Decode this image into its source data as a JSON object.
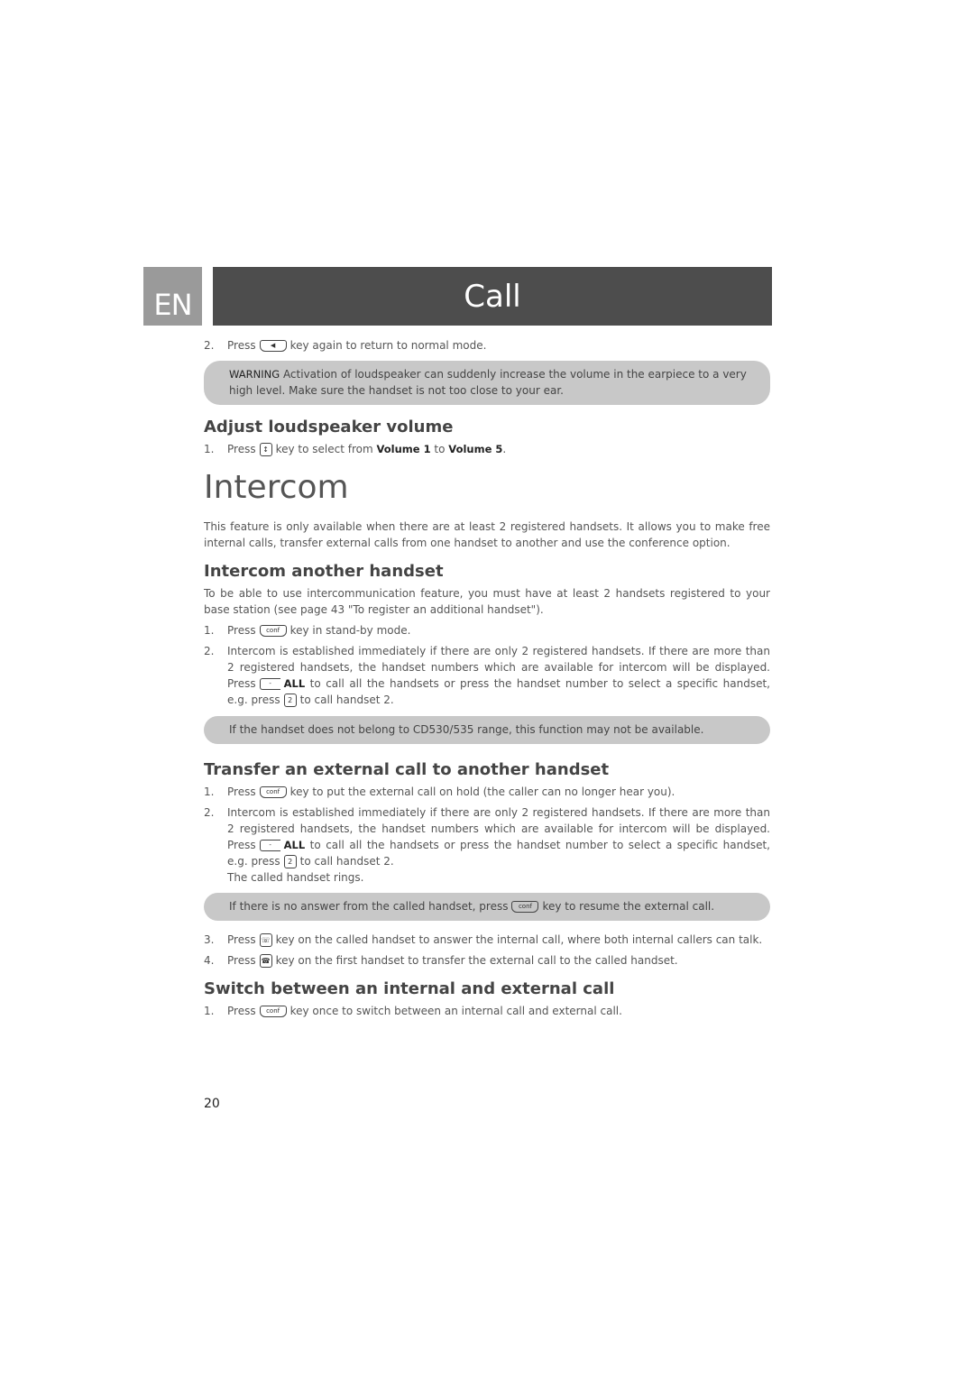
{
  "header": {
    "language_tab": "EN",
    "chapter_title": "Call",
    "colors": {
      "title_bar": "#4d4d4d",
      "language_tab": "#9a9a9a",
      "note_bg": "#c8c8c8"
    }
  },
  "intro_step": {
    "num": "2.",
    "pre": "Press",
    "key_icon": "speaker-key",
    "post": "key again to return to normal mode."
  },
  "warning_note": {
    "label": "WARNING",
    "text": "Activation of loudspeaker can suddenly increase the volume in the earpiece to a very high level. Make sure the handset is not too close to your ear."
  },
  "adjust_section": {
    "heading": "Adjust loudspeaker volume",
    "step": {
      "num": "1.",
      "pre": "Press",
      "key_icon": "volume-key",
      "mid": "key to select from",
      "bold1": "Volume 1",
      "to": "to",
      "bold2": "Volume 5",
      "end": "."
    }
  },
  "intercom": {
    "title": "Intercom",
    "intro": "This feature is only available when there are at least 2 registered handsets. It allows you to make free internal calls, transfer external calls from one handset to another and use the conference option."
  },
  "intercom_another": {
    "heading": "Intercom another handset",
    "intro": "To be able to use intercommunication feature, you must have at least 2 handsets registered to your base station (see page 43 \"To register an additional handset\").",
    "step1": {
      "num": "1.",
      "pre": "Press",
      "key_icon": "conf-key",
      "key_label": "conf",
      "post": "key in stand-by mode."
    },
    "step2": {
      "num": "2.",
      "text1": "Intercom is established immediately if there are only 2 registered handsets. If there are more than 2 registered handsets, the handset numbers which are available for intercom will be displayed. Press",
      "bold": "ALL",
      "text2": "to call all the handsets or press the handset number to select a specific handset, e.g. press",
      "key_label": "2",
      "text3": "to call handset 2."
    },
    "note": "If the handset does not belong to CD530/535 range, this function may not be available."
  },
  "transfer": {
    "heading": "Transfer an external call to another handset",
    "step1": {
      "num": "1.",
      "pre": "Press",
      "key_label": "conf",
      "post": "key to put the external call on hold (the caller can no longer hear you)."
    },
    "step2": {
      "num": "2.",
      "text1": "Intercom is established immediately if there are only 2 registered handsets. If there are more than 2 registered handsets, the handset numbers which are available for intercom will be displayed. Press",
      "bold": "ALL",
      "text2": "to call all the handsets or press the handset number to select a specific handset, e.g. press",
      "key_label": "2",
      "text3": "to call handset 2.",
      "extra": "The called handset rings."
    },
    "note": {
      "pre": "If there is no answer from the called handset, press",
      "key_label": "conf",
      "post": "key to resume the external call."
    },
    "step3": {
      "num": "3.",
      "pre": "Press",
      "key_icon": "talk-key",
      "post": "key on the called handset to answer the internal call, where both internal callers can talk."
    },
    "step4": {
      "num": "4.",
      "pre": "Press",
      "key_icon": "hangup-key",
      "post": "key on the first handset to transfer the external call to the called handset."
    }
  },
  "switch": {
    "heading": "Switch between an internal and external call",
    "step1": {
      "num": "1.",
      "pre": "Press",
      "key_label": "conf",
      "post": "key once to switch between an internal call and external call."
    }
  },
  "page_number": "20"
}
